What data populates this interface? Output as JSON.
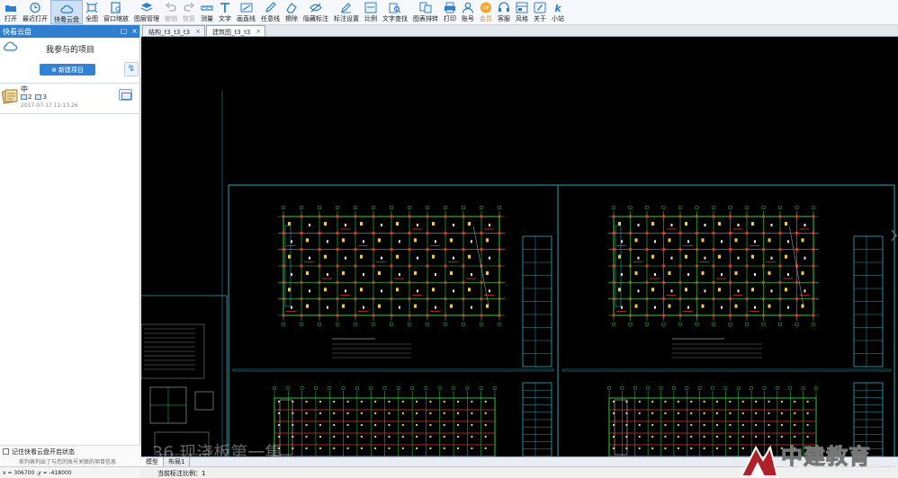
{
  "toolbar": {
    "items": [
      {
        "label": "打开",
        "icon": "folder-open-icon",
        "state": "normal"
      },
      {
        "label": "最近打开",
        "icon": "clock-icon",
        "state": "normal"
      },
      {
        "label": "快看云盘",
        "icon": "cloud-icon",
        "state": "active"
      },
      {
        "label": "全图",
        "icon": "fit-all-icon",
        "state": "normal"
      },
      {
        "label": "窗口缩放",
        "icon": "window-zoom-icon",
        "state": "normal"
      },
      {
        "label": "图层管理",
        "icon": "layers-icon",
        "state": "normal"
      },
      {
        "label": "撤销",
        "icon": "undo-icon",
        "state": "disabled"
      },
      {
        "label": "恢复",
        "icon": "redo-icon",
        "state": "disabled"
      },
      {
        "label": "测量",
        "icon": "measure-icon",
        "state": "normal"
      },
      {
        "label": "文字",
        "icon": "text-icon",
        "state": "normal"
      },
      {
        "label": "画直线",
        "icon": "line-icon",
        "state": "normal"
      },
      {
        "label": "任意线",
        "icon": "pen-icon",
        "state": "normal"
      },
      {
        "label": "擦除",
        "icon": "eraser-icon",
        "state": "normal"
      },
      {
        "label": "隐藏标注",
        "icon": "eye-hide-icon",
        "state": "normal"
      },
      {
        "label": "标注设置",
        "icon": "annotation-settings-icon",
        "state": "normal"
      },
      {
        "label": "比例",
        "icon": "scale-icon",
        "state": "normal"
      },
      {
        "label": "文字查找",
        "icon": "text-search-icon",
        "state": "normal"
      },
      {
        "label": "图表排转",
        "icon": "convert-icon",
        "state": "normal"
      },
      {
        "label": "打印",
        "icon": "print-icon",
        "state": "normal"
      },
      {
        "label": "账号",
        "icon": "user-icon",
        "state": "normal"
      },
      {
        "label": "会员",
        "icon": "vip-icon",
        "state": "vip"
      },
      {
        "label": "客服",
        "icon": "headset-icon",
        "state": "normal"
      },
      {
        "label": "风格",
        "icon": "skin-icon",
        "state": "normal"
      },
      {
        "label": "关于",
        "icon": "info-icon",
        "state": "normal"
      },
      {
        "label": "小站",
        "icon": "k-logo-icon",
        "state": "normal"
      }
    ]
  },
  "panel": {
    "title": "快看云盘",
    "heading": "我参与的项目",
    "new_project_label": "新建项目",
    "project": {
      "name": "中",
      "file_count": "2",
      "member_count": "3",
      "date": "2017-07-17 11:13:26"
    },
    "remember_label": "记住快看云盘开启状态",
    "hint": "依列表列出了与您的账号关联的项目信息",
    "coords": "x = 306700 ,y = -418000"
  },
  "tabs": [
    {
      "label": "结构_t3_t3_t3",
      "active": false
    },
    {
      "label": "建筑图_t3_t3",
      "active": true
    }
  ],
  "layout_tabs": [
    "模型",
    "布局1"
  ],
  "status": "当前标注比例：1",
  "overlay_title": "36.现浇板第一集",
  "logo": {
    "cn": "中建教育",
    "en": "CENTURYCHINESECONSTRUCTION"
  },
  "colors": {
    "accent": "#2f7fd1",
    "cad_green": "#33d14a",
    "cad_red": "#e0351f",
    "cad_yellow": "#e8d23a",
    "cad_cyan": "#32c8d8",
    "cad_white": "#e8e8e8"
  }
}
